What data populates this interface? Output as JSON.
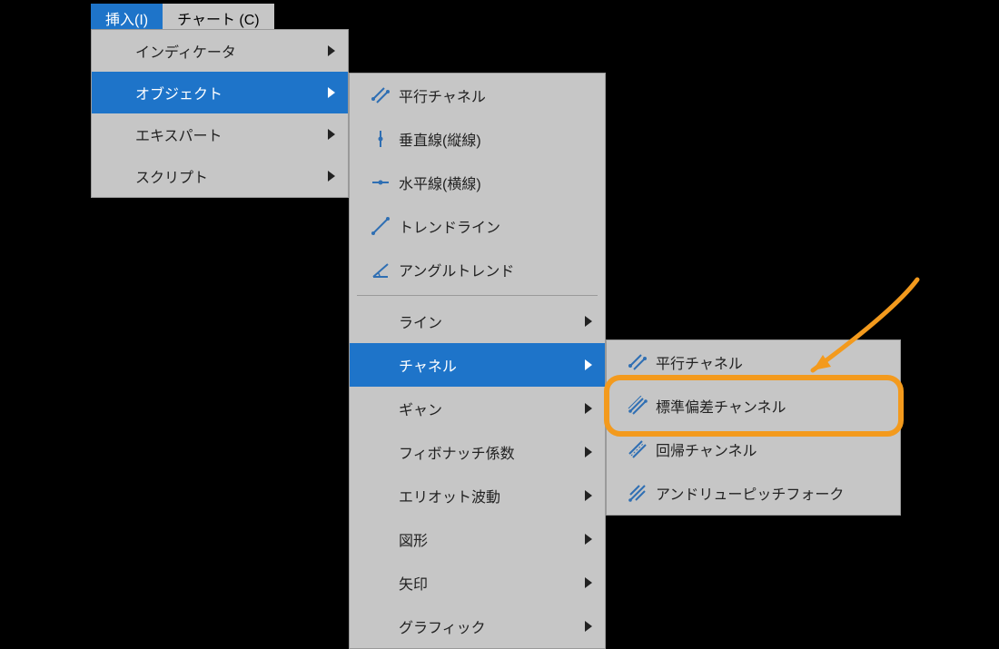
{
  "menubar": {
    "tabs": [
      {
        "label": "挿入(I)",
        "active": true
      },
      {
        "label": "チャート (C)",
        "active": false
      }
    ]
  },
  "menuA": {
    "items": [
      {
        "label": "インディケータ",
        "has_submenu": true,
        "selected": false
      },
      {
        "label": "オブジェクト",
        "has_submenu": true,
        "selected": true
      },
      {
        "label": "エキスパート",
        "has_submenu": true,
        "selected": false
      },
      {
        "label": "スクリプト",
        "has_submenu": true,
        "selected": false
      }
    ]
  },
  "menuB": {
    "group1": [
      {
        "label": "平行チャネル",
        "icon": "parallel-channel"
      },
      {
        "label": "垂直線(縦線)",
        "icon": "vertical-line"
      },
      {
        "label": "水平線(横線)",
        "icon": "horizontal-line"
      },
      {
        "label": "トレンドライン",
        "icon": "trend-line"
      },
      {
        "label": "アングルトレンド",
        "icon": "angle-trend"
      }
    ],
    "group2": [
      {
        "label": "ライン",
        "has_submenu": true,
        "selected": false
      },
      {
        "label": "チャネル",
        "has_submenu": true,
        "selected": true
      },
      {
        "label": "ギャン",
        "has_submenu": true,
        "selected": false
      },
      {
        "label": "フィボナッチ係数",
        "has_submenu": true,
        "selected": false
      },
      {
        "label": "エリオット波動",
        "has_submenu": true,
        "selected": false
      },
      {
        "label": "図形",
        "has_submenu": true,
        "selected": false
      },
      {
        "label": "矢印",
        "has_submenu": true,
        "selected": false
      },
      {
        "label": "グラフィック",
        "has_submenu": true,
        "selected": false
      }
    ]
  },
  "menuC": {
    "items": [
      {
        "label": "平行チャネル",
        "icon": "parallel-channel"
      },
      {
        "label": "標準偏差チャンネル",
        "icon": "stddev-channel",
        "highlighted": true
      },
      {
        "label": "回帰チャンネル",
        "icon": "regression-channel"
      },
      {
        "label": "アンドリューピッチフォーク",
        "icon": "pitchfork"
      }
    ]
  },
  "colors": {
    "accent": "#1e74c9",
    "panel": "#c6c6c6",
    "highlight": "#f39a1d",
    "iconBlue": "#2f6fb3"
  }
}
